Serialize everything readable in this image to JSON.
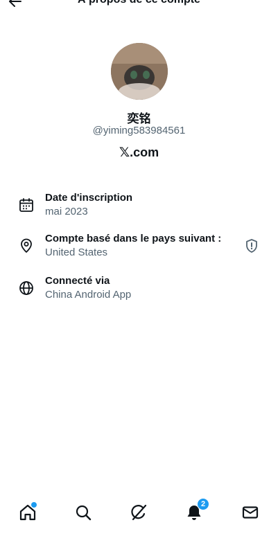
{
  "header": {
    "title": "À propos de ce compte"
  },
  "profile": {
    "display_name": "奕铭",
    "handle": "@yiming583984561",
    "brand_mark": "𝕏",
    "brand_text": ".com"
  },
  "info_rows": [
    {
      "title": "Date d'inscription",
      "value": "mai 2023",
      "icon": "calendar-icon"
    },
    {
      "title": "Compte basé dans le pays suivant :",
      "value": "United States",
      "icon": "location-pin-icon"
    },
    {
      "title": "Connecté via",
      "value": "China Android App",
      "icon": "globe-icon"
    }
  ],
  "bottom_nav": {
    "items": [
      "home-icon",
      "search-icon",
      "grok-icon",
      "bell-icon",
      "mail-icon"
    ],
    "notifications_count": "2"
  },
  "colors": {
    "text_primary": "#0f1419",
    "text_secondary": "#536471",
    "accent": "#1d9bf0"
  }
}
